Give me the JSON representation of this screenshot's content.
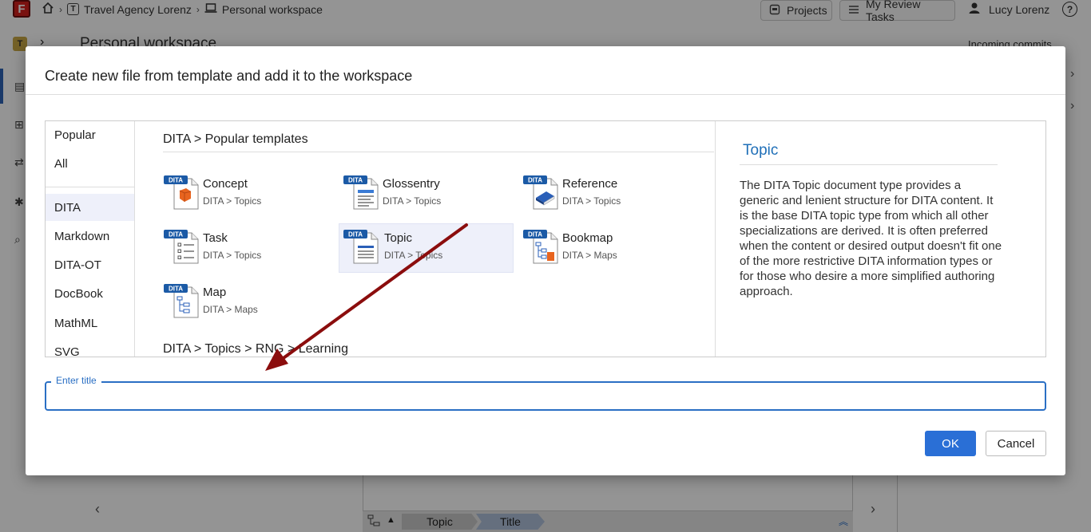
{
  "app": {
    "logo_letter": "F",
    "breadcrumb": [
      "Travel Agency Lorenz",
      "Personal workspace"
    ],
    "breadcrumb_badge": "T",
    "projects_label": "Projects",
    "review_label": "My Review Tasks",
    "user_name": "Lucy Lorenz",
    "help_glyph": "?",
    "workspace_badge": "T",
    "workspace_title": "Personal workspace",
    "incoming_label": "Incoming commits",
    "crumb_topic": "Topic",
    "crumb_title": "Title"
  },
  "dialog": {
    "title": "Create new file from template and add it to the workspace",
    "categories": [
      "Popular",
      "All",
      "DITA",
      "Markdown",
      "DITA-OT",
      "DocBook",
      "MathML",
      "SVG"
    ],
    "active_category": "DITA",
    "section_heading": "DITA > Popular templates",
    "section_heading_2": "DITA > Topics > RNG > Learning",
    "dita_badge": "DITA",
    "templates": [
      {
        "name": "Concept",
        "path": "DITA > Topics",
        "icon": "concept-icon"
      },
      {
        "name": "Glossentry",
        "path": "DITA > Topics",
        "icon": "glossentry-icon"
      },
      {
        "name": "Reference",
        "path": "DITA > Topics",
        "icon": "reference-icon"
      },
      {
        "name": "Task",
        "path": "DITA > Topics",
        "icon": "task-icon"
      },
      {
        "name": "Topic",
        "path": "DITA > Topics",
        "icon": "topic-icon"
      },
      {
        "name": "Bookmap",
        "path": "DITA > Maps",
        "icon": "bookmap-icon"
      },
      {
        "name": "Map",
        "path": "DITA > Maps",
        "icon": "map-icon"
      }
    ],
    "selected_template": "Topic",
    "details": {
      "title": "Topic",
      "description": "The DITA Topic document type provides a generic and lenient structure for DITA content. It is the base DITA topic type from which all other specializations are derived. It is often preferred when the content or desired output doesn't fit one of the more restrictive DITA information types or for those who desire a more simplified authoring approach."
    },
    "title_field": {
      "label": "Enter title",
      "value": ""
    },
    "ok_label": "OK",
    "cancel_label": "Cancel"
  },
  "colors": {
    "accent": "#2a6fd6",
    "detail_title": "#1f6fb8",
    "arrow": "#8b0d0d",
    "selected_bg": "#eef0fa"
  }
}
